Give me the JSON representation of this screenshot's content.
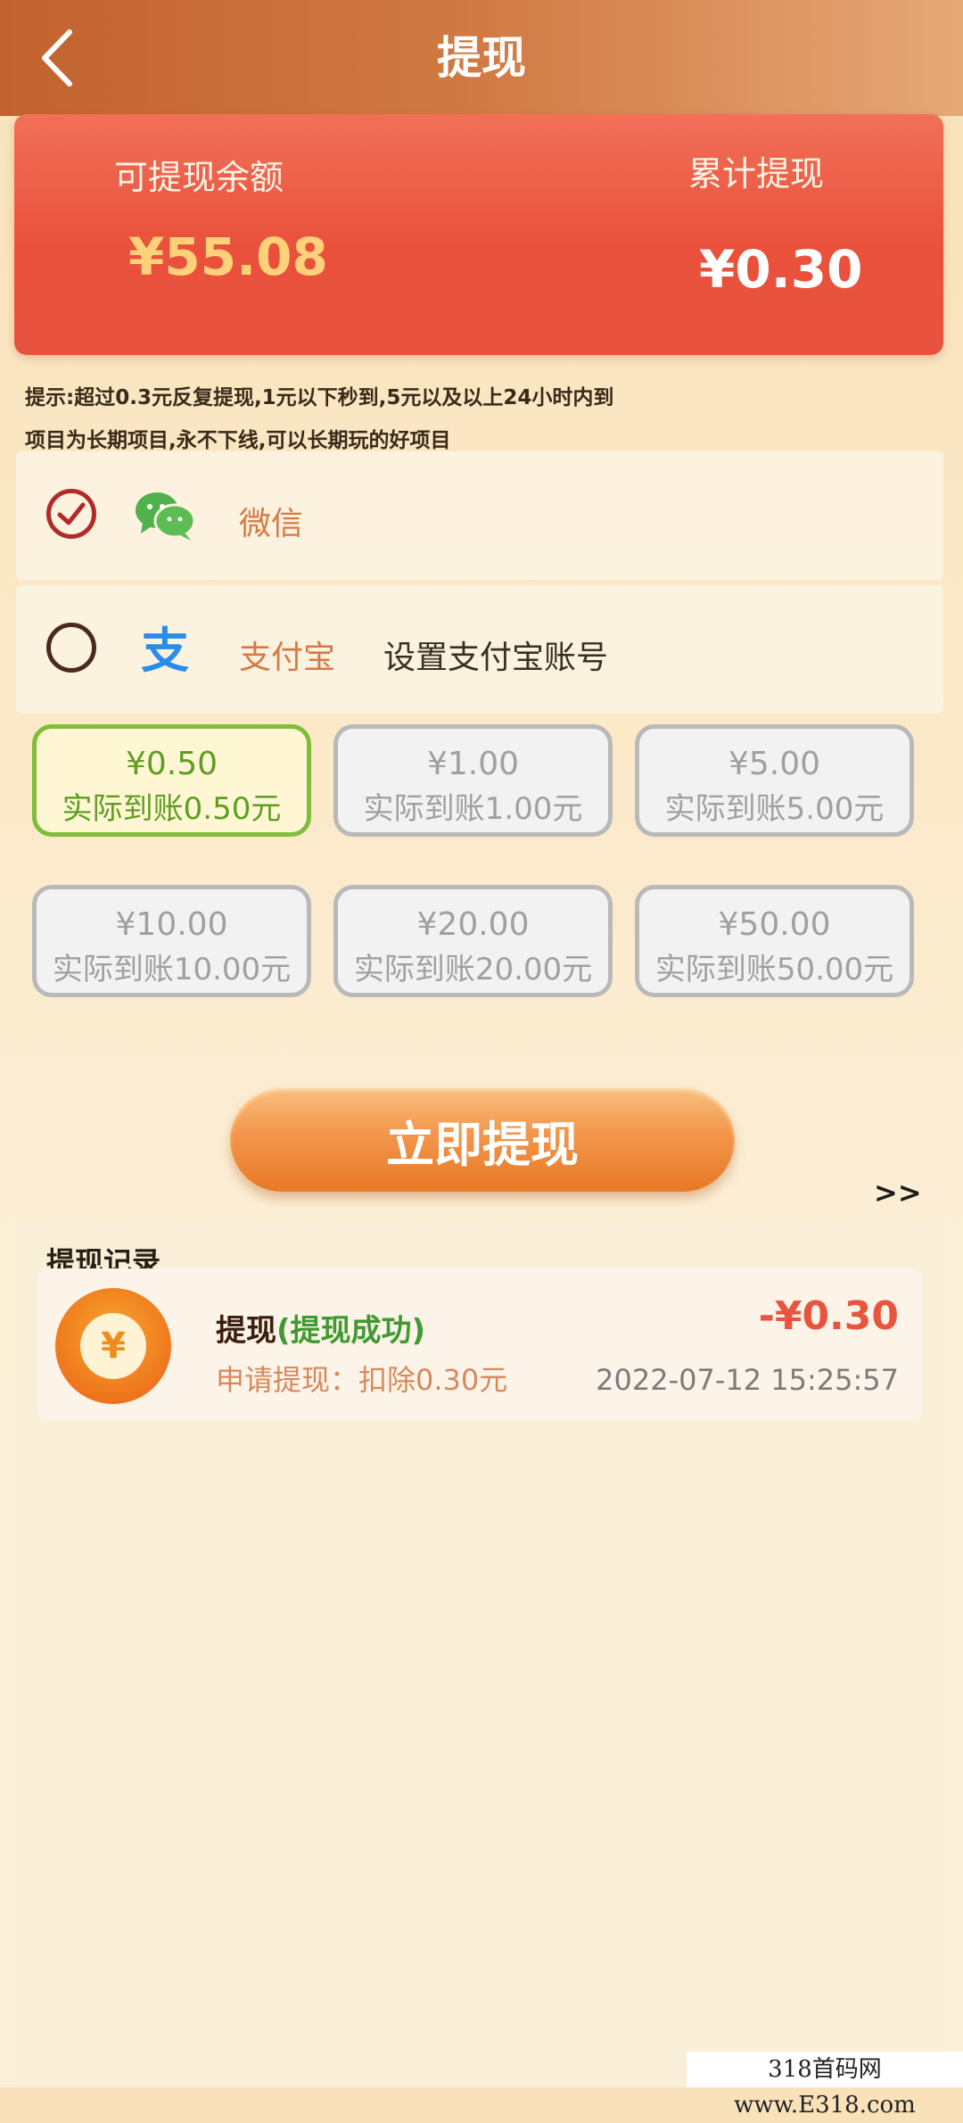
{
  "header": {
    "title": "提现"
  },
  "balance": {
    "available_label": "可提现余额",
    "available_value": "¥55.08",
    "total_label": "累计提现",
    "total_value": "¥0.30"
  },
  "notice": {
    "line1": "提示:超过0.3元反复提现,1元以下秒到,5元以及以上24小时内到",
    "line2": "项目为长期项目,永不下线,可以长期玩的好项目"
  },
  "payment_methods": [
    {
      "name": "微信",
      "selected": true
    },
    {
      "name": "支付宝",
      "selected": false,
      "setup_text": "设置支付宝账号"
    }
  ],
  "amounts": [
    {
      "amount": "¥0.50",
      "actual": "实际到账0.50元",
      "selected": true
    },
    {
      "amount": "¥1.00",
      "actual": "实际到账1.00元",
      "selected": false
    },
    {
      "amount": "¥5.00",
      "actual": "实际到账5.00元",
      "selected": false
    },
    {
      "amount": "¥10.00",
      "actual": "实际到账10.00元",
      "selected": false
    },
    {
      "amount": "¥20.00",
      "actual": "实际到账20.00元",
      "selected": false
    },
    {
      "amount": "¥50.00",
      "actual": "实际到账50.00元",
      "selected": false
    }
  ],
  "withdraw_button": "立即提现",
  "more_link": ">>",
  "records": {
    "title": "提现记录",
    "items": [
      {
        "title": "提现",
        "status": "(提现成功)",
        "desc": "申请提现：扣除0.30元",
        "amount": "-¥0.30",
        "time": "2022-07-12   15:25:57"
      }
    ]
  },
  "watermark": "318首码网 www.E318.com",
  "colors": {
    "header_start": "#c2622f",
    "card_red": "#ea553f",
    "balance_gold": "#ffd27a",
    "selected_green": "#7fbd3a",
    "success_green": "#3f9a32",
    "button_orange": "#f2954a"
  }
}
